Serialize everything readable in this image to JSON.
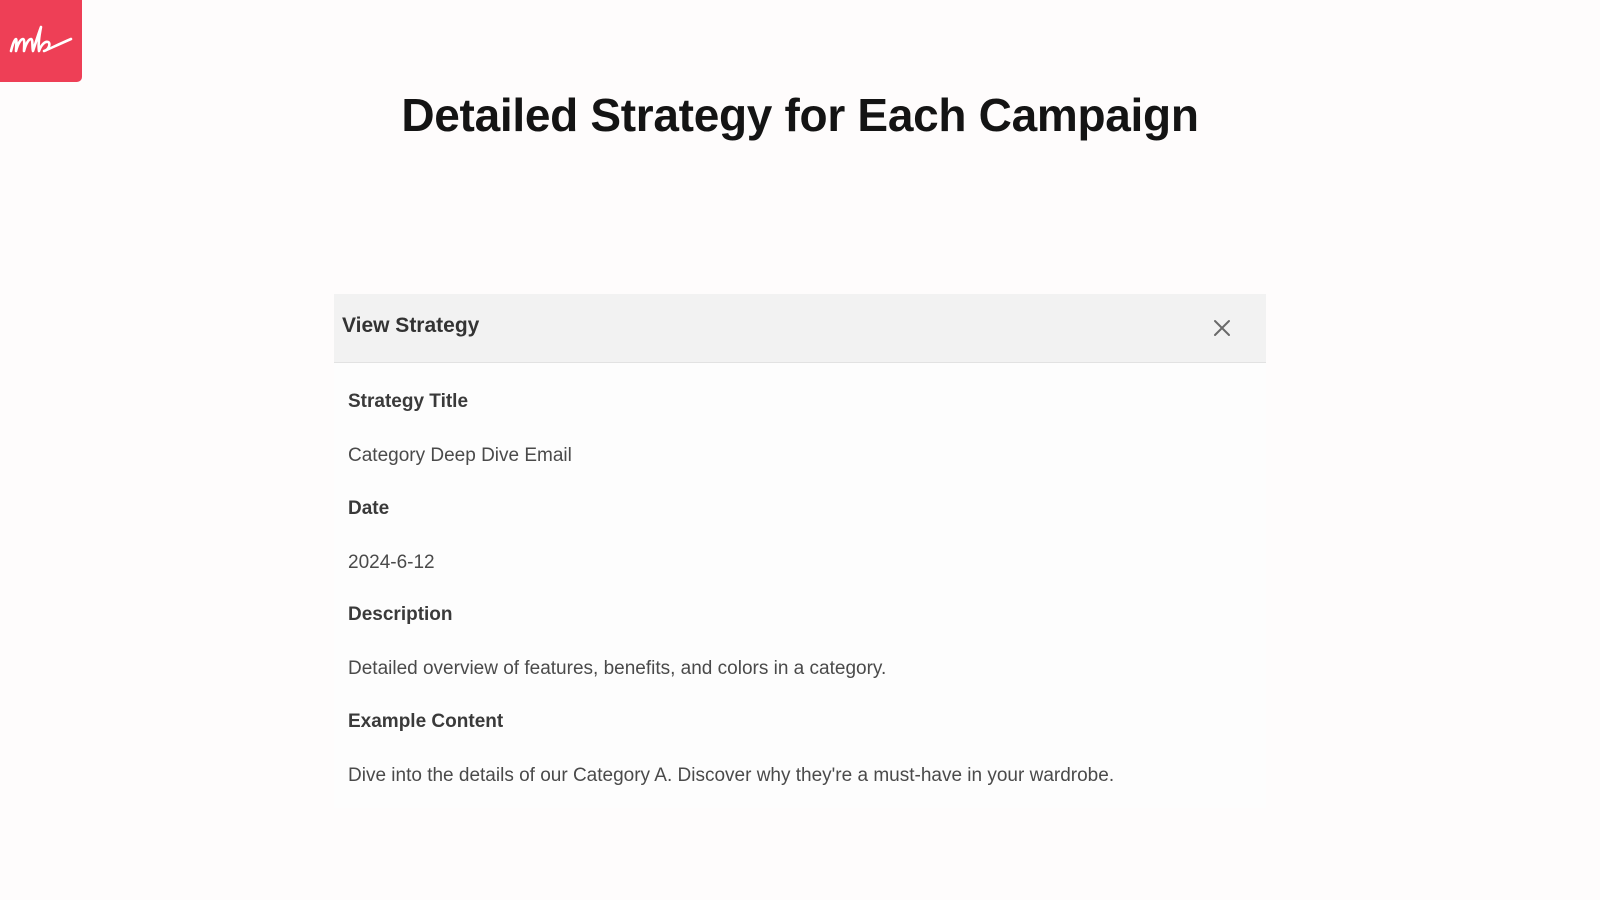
{
  "logo": {
    "text": "mb",
    "color": "#ee3f56"
  },
  "page_title": "Detailed Strategy for Each Campaign",
  "dialog": {
    "title": "View Strategy",
    "close_icon": "close-icon",
    "fields": [
      {
        "label": "Strategy Title",
        "value": "Category Deep Dive Email"
      },
      {
        "label": "Date",
        "value": "2024-6-12"
      },
      {
        "label": "Description",
        "value": "Detailed overview of features, benefits, and colors in a category."
      },
      {
        "label": "Example Content",
        "value": "Dive into the details of our Category A. Discover why they're a must-have in your wardrobe."
      }
    ]
  }
}
